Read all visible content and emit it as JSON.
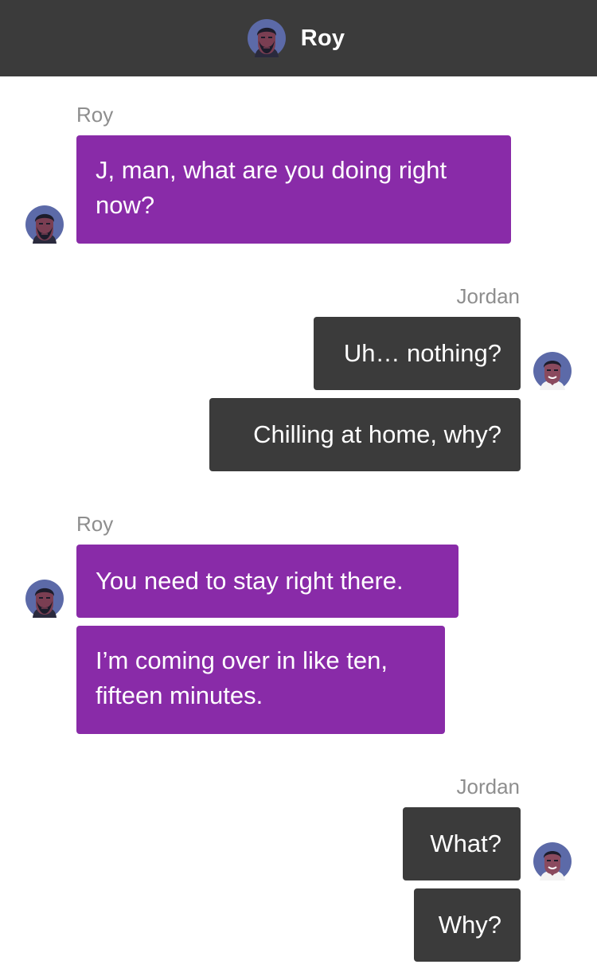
{
  "header": {
    "title": "Roy",
    "avatar_icon": "roy-avatar-icon"
  },
  "colors": {
    "header_bg": "#3b3b3b",
    "roy_bubble": "#892ba8",
    "jordan_bubble": "#3b3b3b",
    "sender_label": "#8e8e8e"
  },
  "messages": [
    {
      "sender": "Roy",
      "bubbles": [
        "J, man, what are you doing right now?"
      ]
    },
    {
      "sender": "Jordan",
      "bubbles": [
        "Uh… nothing?",
        "Chilling at home, why?"
      ]
    },
    {
      "sender": "Roy",
      "bubbles": [
        "You need to stay right there.",
        "I’m coming over in like ten, fifteen minutes."
      ]
    },
    {
      "sender": "Jordan",
      "bubbles": [
        "What?",
        "Why?"
      ]
    }
  ]
}
